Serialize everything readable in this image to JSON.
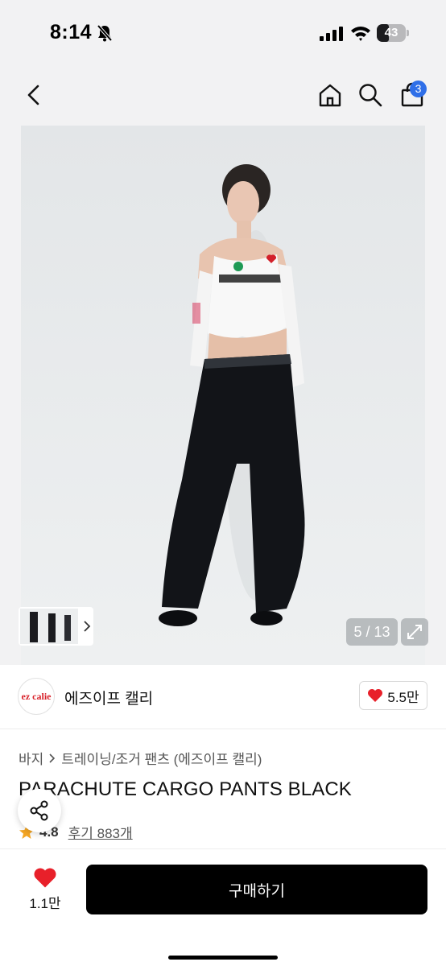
{
  "status_bar": {
    "time": "8:14",
    "battery": "43",
    "battery_level": 0.43,
    "icons": [
      "bell-slash-icon",
      "signal-icon",
      "wifi-icon",
      "battery-icon"
    ]
  },
  "nav": {
    "icons": [
      "back-icon",
      "home-icon",
      "search-icon",
      "bag-icon"
    ],
    "cart_count": "3"
  },
  "gallery": {
    "counter": "5 / 13",
    "icons": [
      "chevron-right-icon",
      "expand-icon"
    ]
  },
  "brand": {
    "logo_text": "ez calie",
    "name": "에즈이프 캘리",
    "likes": "5.5만"
  },
  "product": {
    "breadcrumb": [
      "바지",
      "트레이닝/조거 팬츠 (에즈이프 캘리)"
    ],
    "title": "PARACHUTE CARGO PANTS BLACK",
    "rating": "4.8",
    "reviews": "후기 883개"
  },
  "bottom_bar": {
    "wish_count": "1.1만",
    "buy_label": "구매하기"
  },
  "colors": {
    "accent_blue": "#2f6fe8",
    "heart_red": "#e8202a",
    "star_orange": "#f5a623",
    "buy_button": "#000000"
  }
}
